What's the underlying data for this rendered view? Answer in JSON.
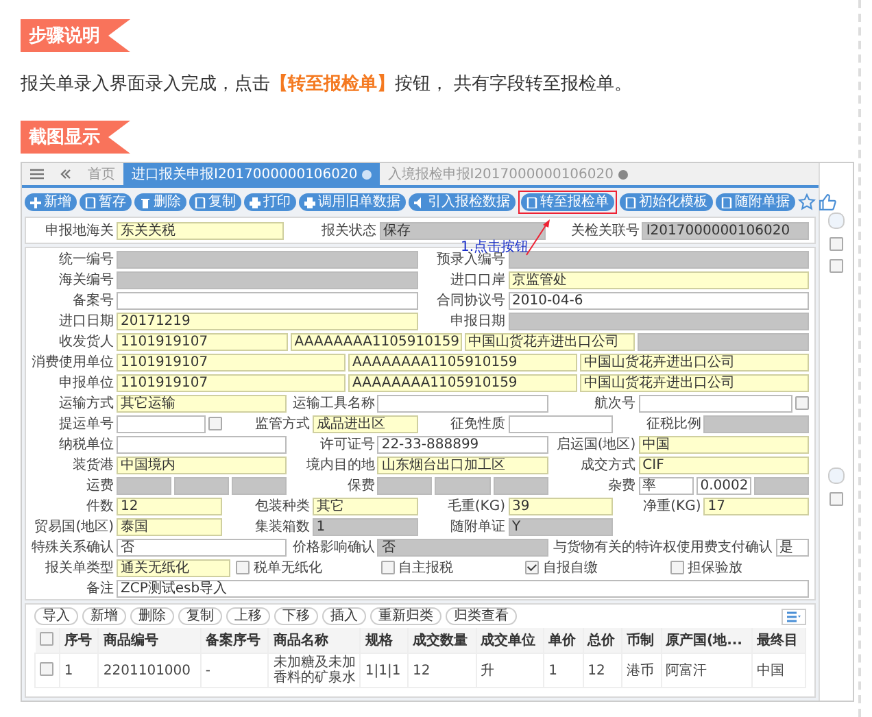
{
  "sections": [
    {
      "title": "步骤说明",
      "paragraph": "报关单录入界面录入完成，点击**【转至报检单】**按钮， 共有字段转至报检单。"
    },
    {
      "title": "截图显示"
    }
  ],
  "screenshot": {
    "tabs": [
      {
        "label": "首页",
        "selected": false,
        "closable": false
      },
      {
        "label": "进口报关申报I2017000000106020",
        "selected": true,
        "closable": true
      },
      {
        "label": "入境报检申报I2017000000106020",
        "selected": false,
        "closable": true
      }
    ],
    "toolbar": [
      {
        "label": "新增",
        "highlighted": false
      },
      {
        "label": "暂存",
        "highlighted": false
      },
      {
        "label": "删除",
        "highlighted": false
      },
      {
        "label": "复制",
        "highlighted": false
      },
      {
        "label": "打印",
        "highlighted": false
      },
      {
        "label": "调用旧单数据",
        "highlighted": false
      },
      {
        "label": "引入报检数据",
        "highlighted": false
      },
      {
        "label": "转至报检单",
        "highlighted": true
      },
      {
        "label": "初始化模板",
        "highlighted": false
      },
      {
        "label": "随附单据",
        "highlighted": false
      }
    ],
    "annotation": "1.点击按钮",
    "header": [
      {
        "label": "申报地海关",
        "inputs": [
          {
            "kind": "required",
            "value": "东关关税"
          }
        ]
      },
      {
        "label": "报关状态",
        "inputs": [
          {
            "kind": "readonly",
            "value": "保存"
          }
        ]
      },
      {
        "label": "关检关联号",
        "inputs": [
          {
            "kind": "readonly",
            "value": "I2017000000106020"
          }
        ]
      }
    ],
    "form": {
      "rows": [
        {
          "groups": [
            {
              "kind": "field",
              "label": "统一编号",
              "inputs": [
                {
                  "kind": "readonly"
                }
              ]
            },
            {
              "kind": "field",
              "label": "预录入编号",
              "inputs": [
                {
                  "kind": "readonly"
                }
              ]
            }
          ]
        },
        {
          "groups": [
            {
              "kind": "field",
              "label": "海关编号",
              "inputs": [
                {
                  "kind": "readonly"
                }
              ]
            },
            {
              "kind": "field",
              "label": "进口口岸",
              "inputs": [
                {
                  "kind": "required",
                  "value": "京监管处"
                }
              ]
            }
          ]
        },
        {
          "groups": [
            {
              "kind": "field",
              "label": "备案号",
              "inputs": [
                {
                  "kind": "plain"
                }
              ]
            },
            {
              "kind": "field",
              "label": "合同协议号",
              "inputs": [
                {
                  "kind": "plain",
                  "value": "2010-04-6"
                }
              ]
            }
          ]
        },
        {
          "groups": [
            {
              "kind": "field",
              "label": "进口日期",
              "inputs": [
                {
                  "kind": "required",
                  "value": "20171219"
                }
              ]
            },
            {
              "kind": "field",
              "label": "申报日期",
              "inputs": [
                {
                  "kind": "readonly"
                }
              ]
            }
          ]
        },
        {
          "groups": [
            {
              "kind": "field",
              "label": "收发货人",
              "inputs": [
                {
                  "kind": "required",
                  "value": "1101919107"
                },
                {
                  "kind": "required",
                  "value": "AAAAAAAA1105910159"
                },
                {
                  "kind": "required",
                  "value": "中国山货花卉进出口公司"
                },
                {
                  "kind": "readonly"
                }
              ]
            }
          ]
        },
        {
          "groups": [
            {
              "kind": "field",
              "label": "消费使用单位",
              "inputs": [
                {
                  "kind": "required",
                  "value": "1101919107"
                },
                {
                  "kind": "required",
                  "value": "AAAAAAAA1105910159"
                },
                {
                  "kind": "required",
                  "value": "中国山货花卉进出口公司"
                }
              ]
            }
          ]
        },
        {
          "groups": [
            {
              "kind": "field",
              "label": "申报单位",
              "inputs": [
                {
                  "kind": "required",
                  "value": "1101919107"
                },
                {
                  "kind": "required",
                  "value": "AAAAAAAA1105910159"
                },
                {
                  "kind": "required",
                  "value": "中国山货花卉进出口公司"
                }
              ]
            }
          ]
        },
        {
          "groups": [
            {
              "kind": "field",
              "label": "运输方式",
              "inputs": [
                {
                  "kind": "required",
                  "value": "其它运输"
                }
              ]
            },
            {
              "kind": "field",
              "label": "运输工具名称",
              "inputs": [
                {
                  "kind": "plain"
                }
              ]
            },
            {
              "kind": "field",
              "label": "航次号",
              "inputs": [
                {
                  "kind": "plain"
                },
                {
                  "kind": "checkbox",
                  "checked": false
                }
              ]
            }
          ]
        },
        {
          "groups": [
            {
              "kind": "field",
              "label": "提运单号",
              "inputs": [
                {
                  "kind": "plain"
                },
                {
                  "kind": "checkbox",
                  "checked": false
                }
              ]
            },
            {
              "kind": "field",
              "label": "监管方式",
              "inputs": [
                {
                  "kind": "required",
                  "value": "成品进出区"
                }
              ]
            },
            {
              "kind": "field",
              "label": "征免性质",
              "inputs": [
                {
                  "kind": "plain"
                }
              ]
            },
            {
              "kind": "field",
              "label": "征税比例",
              "inputs": [
                {
                  "kind": "readonly"
                }
              ]
            }
          ]
        },
        {
          "groups": [
            {
              "kind": "field",
              "label": "纳税单位",
              "inputs": [
                {
                  "kind": "plain"
                }
              ]
            },
            {
              "kind": "field",
              "label": "许可证号",
              "inputs": [
                {
                  "kind": "plain",
                  "value": "22-33-888899"
                }
              ]
            },
            {
              "kind": "field",
              "label": "启运国(地区)",
              "inputs": [
                {
                  "kind": "required",
                  "value": "中国"
                }
              ]
            }
          ]
        },
        {
          "groups": [
            {
              "kind": "field",
              "label": "装货港",
              "inputs": [
                {
                  "kind": "required",
                  "value": "中国境内"
                }
              ]
            },
            {
              "kind": "field",
              "label": "境内目的地",
              "inputs": [
                {
                  "kind": "required",
                  "value": "山东烟台出口加工区"
                }
              ]
            },
            {
              "kind": "field",
              "label": "成交方式",
              "inputs": [
                {
                  "kind": "required",
                  "value": "CIF"
                }
              ]
            }
          ]
        },
        {
          "groups": [
            {
              "kind": "field",
              "label": "运费",
              "inputs": [
                {
                  "kind": "readonly"
                },
                {
                  "kind": "readonly"
                },
                {
                  "kind": "readonly"
                }
              ]
            },
            {
              "kind": "field",
              "label": "保费",
              "inputs": [
                {
                  "kind": "readonly"
                },
                {
                  "kind": "readonly"
                },
                {
                  "kind": "readonly"
                }
              ]
            },
            {
              "kind": "field",
              "label": "杂费",
              "inputs": [
                {
                  "kind": "plain",
                  "value": "率"
                },
                {
                  "kind": "plain",
                  "value": "0.0002"
                },
                {
                  "kind": "readonly"
                }
              ]
            }
          ]
        },
        {
          "groups": [
            {
              "kind": "field",
              "label": "件数",
              "inputs": [
                {
                  "kind": "required",
                  "value": "12"
                }
              ]
            },
            {
              "kind": "field",
              "label": "包装种类",
              "inputs": [
                {
                  "kind": "required",
                  "value": "其它"
                }
              ]
            },
            {
              "kind": "field",
              "label": "毛重(KG)",
              "inputs": [
                {
                  "kind": "required",
                  "value": "39"
                }
              ]
            },
            {
              "kind": "field",
              "label": "净重(KG)",
              "inputs": [
                {
                  "kind": "required",
                  "value": "17"
                }
              ]
            }
          ]
        },
        {
          "groups": [
            {
              "kind": "field",
              "label": "贸易国(地区)",
              "inputs": [
                {
                  "kind": "required",
                  "value": "泰国"
                }
              ]
            },
            {
              "kind": "field",
              "label": "集装箱数",
              "inputs": [
                {
                  "kind": "readonly",
                  "value": "1"
                }
              ]
            },
            {
              "kind": "field",
              "label": "随附单证",
              "inputs": [
                {
                  "kind": "readonly",
                  "value": "Y"
                }
              ]
            },
            {
              "kind": "spacer"
            }
          ]
        },
        {
          "groups": [
            {
              "kind": "field",
              "label": "特殊关系确认",
              "inputs": [
                {
                  "kind": "plain",
                  "value": "否"
                }
              ]
            },
            {
              "kind": "field",
              "label": "价格影响确认",
              "inputs": [
                {
                  "kind": "readonly",
                  "value": "否"
                }
              ]
            },
            {
              "kind": "field",
              "label": "与货物有关的特许权使用费支付确认",
              "inputs": [
                {
                  "kind": "plain",
                  "value": "是"
                }
              ]
            }
          ]
        },
        {
          "groups": [
            {
              "kind": "field",
              "label": "报关单类型",
              "inputs": [
                {
                  "kind": "required",
                  "value": "通关无纸化"
                }
              ]
            },
            {
              "kind": "check",
              "label": "税单无纸化",
              "checked": false
            },
            {
              "kind": "check",
              "label": "自主报税",
              "checked": false
            },
            {
              "kind": "check",
              "label": "自报自缴",
              "checked": true
            },
            {
              "kind": "check",
              "label": "担保验放",
              "checked": false
            }
          ]
        },
        {
          "groups": [
            {
              "kind": "field",
              "label": "备注",
              "inputs": [
                {
                  "kind": "plain",
                  "value": "ZCP测试esb导入"
                }
              ]
            }
          ]
        }
      ]
    },
    "side_panel": {
      "checkboxes": [
        {
          "checked": false
        },
        {
          "checked": false
        },
        {
          "checked": false
        }
      ]
    },
    "table_toolbar": [
      "导入",
      "新增",
      "删除",
      "复制",
      "上移",
      "下移",
      "插入",
      "重新归类",
      "归类查看"
    ],
    "table": {
      "columns": [
        "序号",
        "商品编号",
        "备案序号",
        "商品名称",
        "规格",
        "成交数量",
        "成交单位",
        "单价",
        "总价",
        "币制",
        "原产国(地...",
        "最终目"
      ],
      "all_checked": false,
      "rows": [
        {
          "checked": false,
          "cells": [
            "1",
            "2201101000",
            "-",
            "未加糖及未加香料的矿泉水",
            "1|1|1",
            "12",
            "升",
            "1",
            "12",
            "港币",
            "阿富汗",
            "中国"
          ]
        }
      ]
    }
  }
}
